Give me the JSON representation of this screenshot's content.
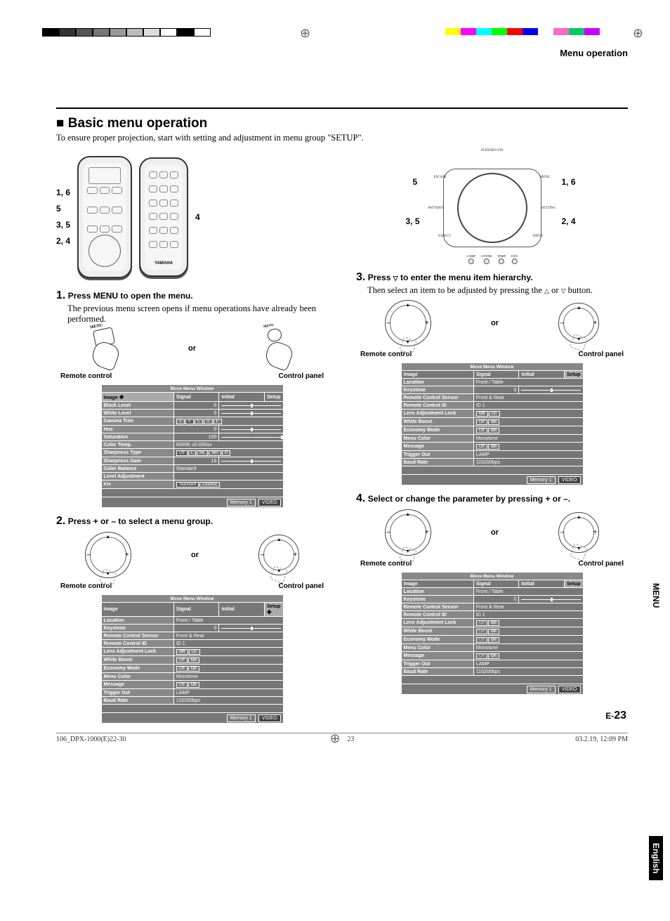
{
  "header": {
    "section": "Menu operation"
  },
  "title": "Basic menu operation",
  "intro": "To ensure proper projection, start with setting and adjustment in menu group \"SETUP\".",
  "remote_step_labels": [
    "1, 6",
    "5",
    "3, 5",
    "2, 4"
  ],
  "remote_right_label": "4",
  "remote_brand": "YAMAHA",
  "panel": {
    "labels": {
      "tl": "5",
      "tr": "1, 6",
      "bl": "3, 5",
      "br": "2, 4"
    },
    "tiny": {
      "top": "STANDBY/ON",
      "escape": "ESCAPE",
      "menu": "MENU",
      "pattern": "PATTERN",
      "setting": "SETTING",
      "aspect": "ASPECT",
      "input": "INPUT"
    },
    "leds": [
      "LAMP",
      "COVER",
      "TEMP",
      "FAN"
    ]
  },
  "steps": {
    "s1": {
      "title": "Press MENU to open the menu.",
      "body": "The previous menu screen opens if menu operations have already been performed."
    },
    "s2": {
      "title": "Press + or – to select a menu group."
    },
    "s3": {
      "title_pre": "Press ",
      "title_post": " to enter the menu item hierarchy.",
      "body_pre": "Then select an item to be adjusted by pressing the ",
      "body_mid": " or ",
      "body_post": " button."
    },
    "s4": {
      "title": "Select or change the parameter by pressing + or –."
    }
  },
  "labels": {
    "or": "or",
    "remote": "Remote control",
    "control_panel": "Control panel",
    "menu_caption": "MENU"
  },
  "menu_window": {
    "title": "Move Menu Window",
    "tabs": [
      "Image",
      "Signal",
      "Initial",
      "Setup"
    ],
    "memory": "Memory 1",
    "video": "VIDEO"
  },
  "image_menu": {
    "rows": [
      {
        "name": "Black Level",
        "val": "0",
        "bar": 50
      },
      {
        "name": "White Level",
        "val": "0",
        "bar": 50
      },
      {
        "name": "Gamma Trim",
        "opts": [
          "A",
          "B",
          "C",
          "D",
          "E"
        ],
        "sel": 1
      },
      {
        "name": "Hue",
        "val": "0",
        "bar": 50
      },
      {
        "name": "Saturation",
        "val": "100",
        "bar": 100
      },
      {
        "name": "Color Temp.",
        "text": "6000K  ±0.000uv"
      },
      {
        "name": "Sharpness Type",
        "opts": [
          "Off",
          "L",
          "ML",
          "MH",
          "H"
        ],
        "sel": 0
      },
      {
        "name": "Sharpness Gain",
        "val": "16",
        "bar": 50
      },
      {
        "name": "Color Balance",
        "text": "Standard"
      },
      {
        "name": "Level Adjustment"
      },
      {
        "name": "Iris",
        "opts": [
          "Standard",
          "Cinema"
        ],
        "sel": 0
      }
    ]
  },
  "setup_menu": {
    "rows": [
      {
        "name": "Location",
        "text": "Front / Table"
      },
      {
        "name": "Keystone",
        "val": "0",
        "bar": 50
      },
      {
        "name": "Remote Control Sensor",
        "text": "Front & Rear"
      },
      {
        "name": "Remote Control ID",
        "text": "ID 1"
      },
      {
        "name": "Lens Adjustment Lock",
        "opts": [
          "Off",
          "On"
        ],
        "sel": 0
      },
      {
        "name": "White Boost",
        "opts": [
          "Off",
          "On"
        ],
        "sel": 1
      },
      {
        "name": "Economy Mode",
        "opts": [
          "Off",
          "On"
        ],
        "sel": 1
      },
      {
        "name": "Menu Color",
        "text": "Monotone"
      },
      {
        "name": "Message",
        "opts": [
          "Off",
          "On"
        ],
        "sel": 1
      },
      {
        "name": "Trigger Out",
        "text": "LAMP"
      },
      {
        "name": "Baud Rate",
        "text": "115200bps"
      }
    ]
  },
  "setup_menu_step2": {
    "rows": [
      {
        "name": "Location",
        "text": "Front / Table"
      },
      {
        "name": "Keystone",
        "val": "0",
        "bar": 50
      },
      {
        "name": "Remote Control Sensor",
        "text": "Front & Rear"
      },
      {
        "name": "Remote Control ID",
        "text": "ID 1"
      },
      {
        "name": "Lens Adjustment Lock",
        "opts": [
          "Off",
          "On"
        ],
        "sel": 0
      },
      {
        "name": "White Boost",
        "opts": [
          "Off",
          "On"
        ],
        "sel": 1
      },
      {
        "name": "Economy Mode",
        "opts": [
          "Off",
          "On"
        ],
        "sel": 1
      },
      {
        "name": "Menu Color",
        "text": "Monotone"
      },
      {
        "name": "Message",
        "opts": [
          "Off",
          "On"
        ],
        "sel": 1
      },
      {
        "name": "Trigger Out",
        "text": "LAMP"
      },
      {
        "name": "Baud Rate",
        "text": "115200bps"
      }
    ]
  },
  "setup_menu_step3": {
    "rows": [
      {
        "name": "Location",
        "text": "Front / Table"
      },
      {
        "name": "Keystone",
        "val": "0",
        "bar": 50
      },
      {
        "name": "Remote Control Sensor",
        "text": "Front & Rear"
      },
      {
        "name": "Remote Control ID",
        "text": "ID 1"
      },
      {
        "name": "Lens Adjustment Lock",
        "opts": [
          "Off",
          "On"
        ],
        "sel": 0
      },
      {
        "name": "White Boost",
        "opts": [
          "Off",
          "On"
        ],
        "sel": 1
      },
      {
        "name": "Economy Mode",
        "opts": [
          "Off",
          "On"
        ],
        "sel": 1
      },
      {
        "name": "Menu Color",
        "text": "Monotone"
      },
      {
        "name": "Message",
        "opts": [
          "Off",
          "On"
        ],
        "sel": 1
      },
      {
        "name": "Trigger Out",
        "text": "LAMP"
      },
      {
        "name": "Baud Rate",
        "text": "115200bps"
      }
    ]
  },
  "setup_menu_step4": {
    "rows": [
      {
        "name": "Location",
        "text": "Front / Table"
      },
      {
        "name": "Keystone",
        "val": "0",
        "bar": 50
      },
      {
        "name": "Remote Control Sensor",
        "text": "Front & Rear"
      },
      {
        "name": "Remote Control ID",
        "text": "ID 1"
      },
      {
        "name": "Lens Adjustment Lock",
        "opts": [
          "Off",
          "On"
        ],
        "dim": true,
        "sel": 1
      },
      {
        "name": "White Boost",
        "opts": [
          "Off",
          "On"
        ],
        "dim": true,
        "sel": 1
      },
      {
        "name": "Economy Mode",
        "opts": [
          "Off",
          "On"
        ],
        "dim_off": true,
        "sel": 1
      },
      {
        "name": "Menu Color",
        "text": "Monotone"
      },
      {
        "name": "Message",
        "opts": [
          "Off",
          "On"
        ],
        "dim_off": true,
        "sel": 1
      },
      {
        "name": "Trigger Out",
        "text": "LAMP"
      },
      {
        "name": "Baud Rate",
        "text": "115200bps"
      }
    ]
  },
  "side": {
    "menu": "MENU",
    "english": "English"
  },
  "page": {
    "prefix": "E-",
    "num": "23"
  },
  "footer": {
    "file": "106_DPX-1000(E)22-30",
    "page": "23",
    "date": "03.2.19, 12:09 PM"
  },
  "color_strips": {
    "left": [
      "#000",
      "#333",
      "#555",
      "#777",
      "#999",
      "#bbb",
      "#ddd",
      "#fff",
      "#000",
      "#fff"
    ],
    "right": [
      "#ff0",
      "#f0f",
      "#0ff",
      "#0f0",
      "#f00",
      "#00f",
      "#fff",
      "#f6c",
      "#0c6",
      "#c0f"
    ]
  }
}
